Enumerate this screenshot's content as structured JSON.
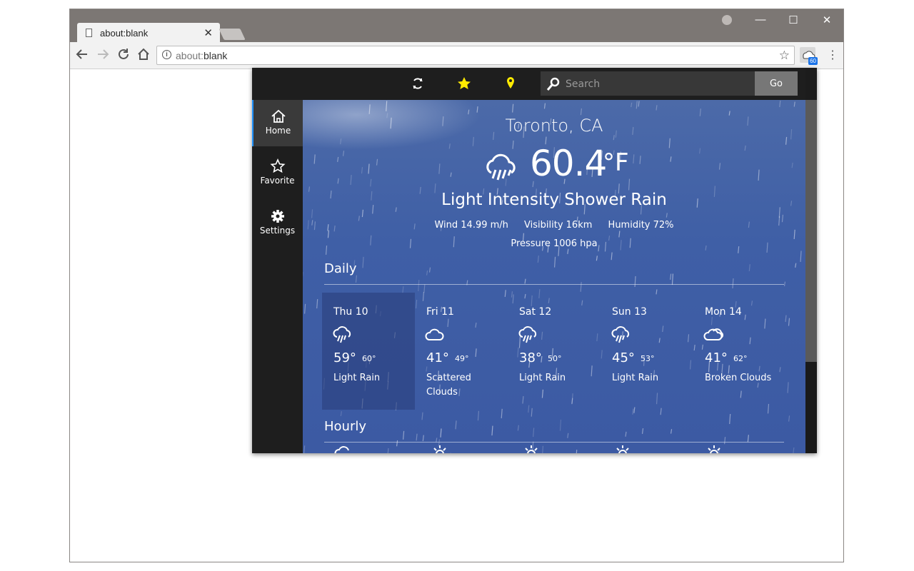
{
  "browser": {
    "tab_title": "about:blank",
    "tab_close": "✕",
    "url_prefix": "about:",
    "url_rest": "blank",
    "ext_badge": "60",
    "controls": {
      "minimize": "—",
      "maximize": "☐",
      "close": "✕"
    }
  },
  "popup": {
    "search": {
      "placeholder": "Search",
      "go_label": "Go"
    },
    "nav": [
      {
        "label": "Home",
        "icon": "home-icon"
      },
      {
        "label": "Favorite",
        "icon": "star-outline-icon"
      },
      {
        "label": "Settings",
        "icon": "gear-icon"
      }
    ],
    "toolbar_icons": [
      "refresh-icon",
      "star-icon",
      "location-pin-icon"
    ],
    "colors": {
      "star": "#ffeb00",
      "pin": "#ffeb00",
      "accent": "#1e90ff"
    },
    "weather": {
      "city": "Toronto, CA",
      "temp": "60.4",
      "unit": "°F",
      "condition": "Light Intensity Shower Rain",
      "wind": "Wind 14.99 m/h",
      "visibility": "Visibility 16km",
      "humidity": "Humidity 72%",
      "pressure": "Pressure 1006 hpa",
      "icon": "rain-cloud-icon"
    },
    "daily_title": "Daily",
    "daily": [
      {
        "day": "Thu 10",
        "hi": "59°",
        "lo": "60°",
        "desc": "Light Rain",
        "icon": "rain-cloud-icon"
      },
      {
        "day": "Fri 11",
        "hi": "41°",
        "lo": "49°",
        "desc": "Scattered Clouds",
        "icon": "cloud-icon"
      },
      {
        "day": "Sat 12",
        "hi": "38°",
        "lo": "50°",
        "desc": "Light Rain",
        "icon": "rain-cloud-icon"
      },
      {
        "day": "Sun 13",
        "hi": "45°",
        "lo": "53°",
        "desc": "Light Rain",
        "icon": "rain-cloud-icon"
      },
      {
        "day": "Mon 14",
        "hi": "41°",
        "lo": "62°",
        "desc": "Broken Clouds",
        "icon": "broken-clouds-icon"
      }
    ],
    "hourly_title": "Hourly"
  }
}
